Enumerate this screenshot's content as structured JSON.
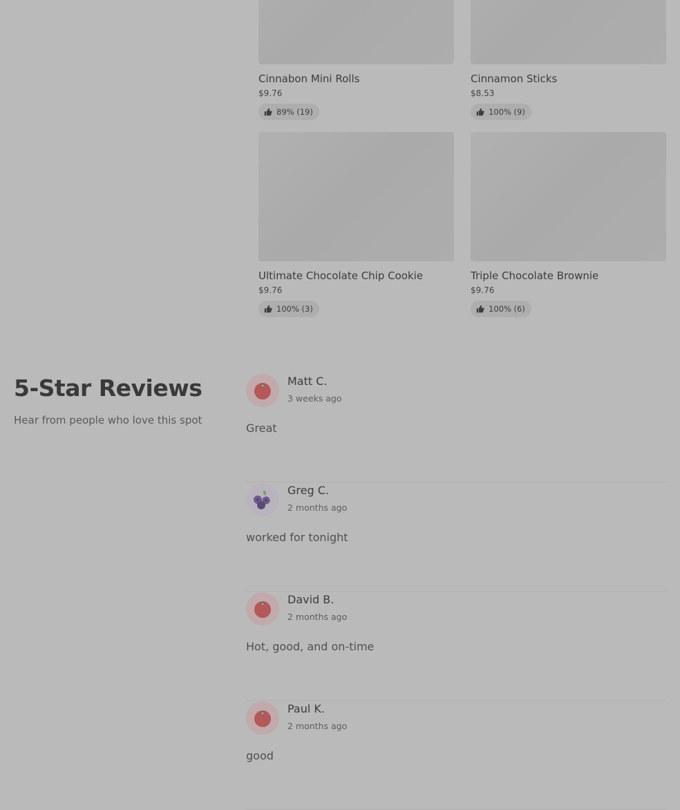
{
  "products": [
    {
      "name": "Cinnabon Mini Rolls",
      "price": "$9.76",
      "rating": "89% (19)"
    },
    {
      "name": "Cinnamon Sticks",
      "price": "$8.53",
      "rating": "100% (9)"
    },
    {
      "name": "Ultimate Chocolate Chip Cookie",
      "price": "$9.76",
      "rating": "100% (3)"
    },
    {
      "name": "Triple Chocolate Brownie",
      "price": "$9.76",
      "rating": "100% (6)"
    }
  ],
  "reviews_section": {
    "title": "5-Star Reviews",
    "subtitle": "Hear from people who love this spot"
  },
  "reviews": [
    {
      "name": "Matt C.",
      "date": "3 weeks ago",
      "text": "Great",
      "avatar_icon": "tomato-avatar-icon"
    },
    {
      "name": "Greg C.",
      "date": "2 months ago",
      "text": "worked for tonight",
      "avatar_icon": "blueberry-avatar-icon"
    },
    {
      "name": "David B.",
      "date": "2 months ago",
      "text": "Hot, good, and on-time",
      "avatar_icon": "tomato-avatar-icon"
    },
    {
      "name": "Paul K.",
      "date": "2 months ago",
      "text": "good",
      "avatar_icon": "tomato-avatar-icon"
    }
  ],
  "colors": {
    "background": "#bababa",
    "text": "#3a3a3a"
  }
}
